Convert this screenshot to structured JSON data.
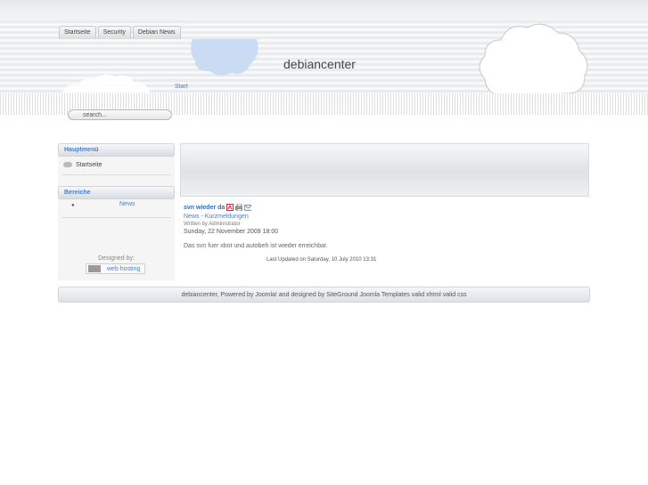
{
  "nav": {
    "tabs": [
      "Startseite",
      "Security",
      "Debian News"
    ]
  },
  "header": {
    "site_title": "debiancenter",
    "breadcrumb": "Start"
  },
  "search": {
    "value": "search..."
  },
  "sidebar": {
    "main_menu": {
      "title": "Hauptmenü",
      "items": [
        "Startseite"
      ]
    },
    "areas": {
      "title": "Bereiche",
      "items": [
        "News"
      ]
    },
    "designed_by": "Designed by:",
    "badge_link": "web hosting"
  },
  "article": {
    "title": "svn wieder da",
    "category": "News - Kurzmeldungen",
    "author": "Written by Administrator",
    "date": "Sunday, 22 November 2009 18:00",
    "body": "Das svn fuer xbot und autobeh ist wieder erreichbar.",
    "updated": "Last Updated on Saturday, 10 July 2010 13:31",
    "icons": [
      "pdf-icon",
      "print-icon",
      "email-icon"
    ]
  },
  "footer": {
    "text": "debiancenter, Powered by Joomla! and designed by SiteGround Joomla Templates valid xhtml valid css"
  },
  "colors": {
    "link": "#4a7fc8",
    "cloud": "#c9dcf4",
    "text": "#444444"
  }
}
